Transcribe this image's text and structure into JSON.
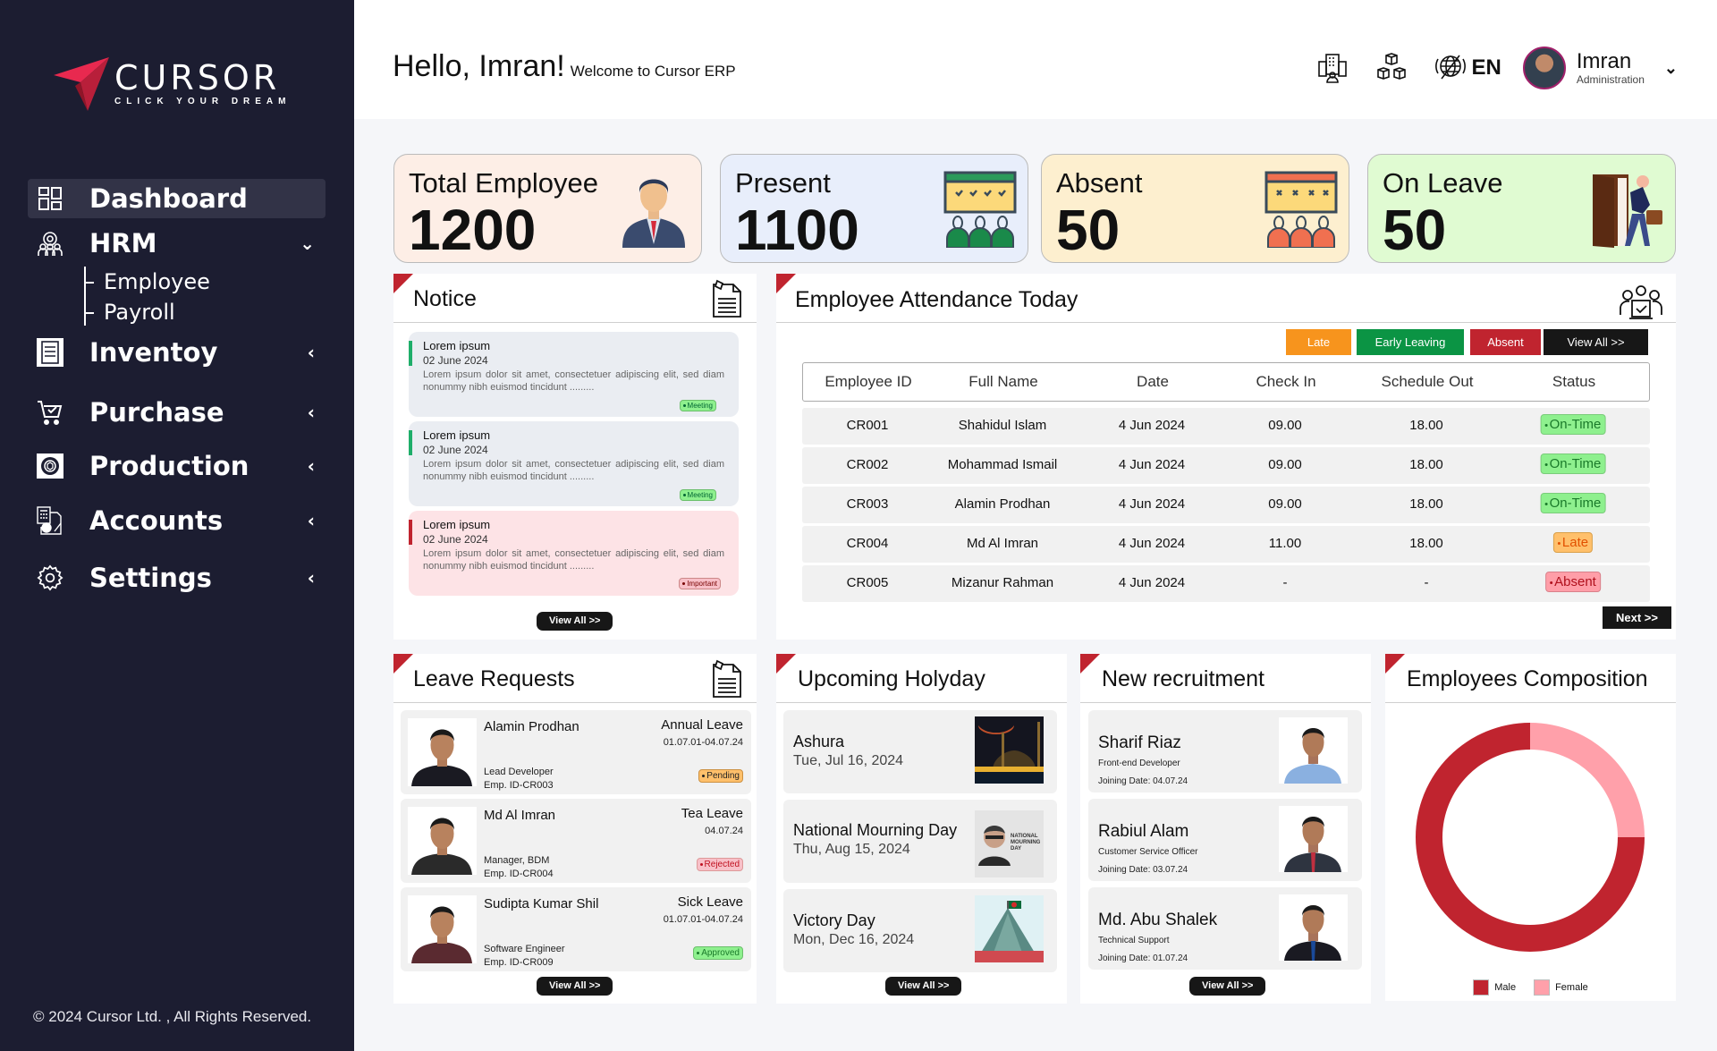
{
  "brand": {
    "name": "CURSOR",
    "tagline": "CLICK YOUR DREAM",
    "accent": "#c0242f"
  },
  "sidebar": {
    "items": [
      {
        "label": "Dashboard",
        "icon": "dashboard-icon",
        "active": true
      },
      {
        "label": "HRM",
        "icon": "hrm-team-gear-icon",
        "expanded": true,
        "children": [
          {
            "label": "Employee"
          },
          {
            "label": "Payroll"
          }
        ]
      },
      {
        "label": "Inventoy",
        "icon": "clipboard-icon"
      },
      {
        "label": "Purchase",
        "icon": "cart-icon"
      },
      {
        "label": "Production",
        "icon": "production-gear-icon"
      },
      {
        "label": "Accounts",
        "icon": "accounts-calculator-icon"
      },
      {
        "label": "Settings",
        "icon": "gear-icon"
      }
    ],
    "footer": "© 2024 Cursor Ltd. , All Rights Reserved."
  },
  "header": {
    "greeting": "Hello, Imran!",
    "subtitle": "Welcome to Cursor ERP",
    "icons": [
      "company-building-icon",
      "modules-boxes-icon",
      "language-globe-icon"
    ],
    "language": "EN",
    "user": {
      "name": "Imran",
      "role": "Administration"
    }
  },
  "stats": [
    {
      "label": "Total Employee",
      "value": "1200",
      "icon": "employee-icon",
      "bg": "#fdeee6"
    },
    {
      "label": "Present",
      "value": "1100",
      "icon": "present-calendar-icon",
      "bg": "#e8eefb"
    },
    {
      "label": "Absent",
      "value": "50",
      "icon": "absent-calendar-icon",
      "bg": "#fdefcf"
    },
    {
      "label": "On Leave",
      "value": "50",
      "icon": "on-leave-door-icon",
      "bg": "#e0fbd2"
    }
  ],
  "notice": {
    "title": "Notice",
    "items": [
      {
        "title": "Lorem ipsum",
        "date": "02 June 2024",
        "body": "Lorem ipsum dolor sit amet, consectetuer adipiscing elit, sed diam nonummy nibh euismod tincidunt .........",
        "tag": "Meeting"
      },
      {
        "title": "Lorem ipsum",
        "date": "02 June 2024",
        "body": "Lorem ipsum dolor sit amet, consectetuer adipiscing elit, sed diam nonummy nibh euismod tincidunt .........",
        "tag": "Meeting"
      },
      {
        "title": "Lorem ipsum",
        "date": "02 June 2024",
        "body": "Lorem ipsum dolor sit amet, consectetuer adipiscing elit, sed diam nonummy nibh euismod tincidunt .........",
        "tag": "Important"
      }
    ],
    "view_all": "View All >>"
  },
  "attendance": {
    "title": "Employee Attendance Today",
    "filters": [
      {
        "label": "Late",
        "color": "#f7941d"
      },
      {
        "label": "Early Leaving",
        "color": "#0b9444"
      },
      {
        "label": "Absent",
        "color": "#c0242f"
      },
      {
        "label": "View All >>",
        "color": "#171717"
      }
    ],
    "columns": [
      "Employee ID",
      "Full Name",
      "Date",
      "Check In",
      "Schedule Out",
      "Status"
    ],
    "rows": [
      {
        "id": "CR001",
        "name": "Shahidul Islam",
        "date": "4 Jun 2024",
        "in": "09.00",
        "out": "18.00",
        "status": "On-Time"
      },
      {
        "id": "CR002",
        "name": "Mohammad Ismail",
        "date": "4 Jun 2024",
        "in": "09.00",
        "out": "18.00",
        "status": "On-Time"
      },
      {
        "id": "CR003",
        "name": "Alamin Prodhan",
        "date": "4 Jun 2024",
        "in": "09.00",
        "out": "18.00",
        "status": "On-Time"
      },
      {
        "id": "CR004",
        "name": "Md Al Imran",
        "date": "4 Jun 2024",
        "in": "11.00",
        "out": "18.00",
        "status": "Late"
      },
      {
        "id": "CR005",
        "name": "Mizanur Rahman",
        "date": "4 Jun 2024",
        "in": "-",
        "out": "-",
        "status": "Absent"
      }
    ],
    "next": "Next >>"
  },
  "leave_requests": {
    "title": "Leave Requests",
    "items": [
      {
        "name": "Alamin Prodhan",
        "role": "Lead Developer",
        "emp_id": "Emp. ID-CR003",
        "type": "Annual Leave",
        "dates": "01.07.01-04.07.24",
        "status": "Pending"
      },
      {
        "name": "Md Al Imran",
        "role": "Manager, BDM",
        "emp_id": "Emp. ID-CR004",
        "type": "Tea Leave",
        "dates": "04.07.24",
        "status": "Rejected"
      },
      {
        "name": "Sudipta Kumar Shil",
        "role": "Software Engineer",
        "emp_id": "Emp. ID-CR009",
        "type": "Sick Leave",
        "dates": "01.07.01-04.07.24",
        "status": "Approved"
      }
    ],
    "view_all": "View All >>"
  },
  "holidays": {
    "title": "Upcoming Holyday",
    "items": [
      {
        "name": "Ashura",
        "date": "Tue, Jul 16, 2024"
      },
      {
        "name": "National Mourning Day",
        "date": "Thu, Aug 15, 2024",
        "image_caption": "NATIONAL MOURNING DAY"
      },
      {
        "name": "Victory Day",
        "date": "Mon, Dec 16, 2024"
      }
    ],
    "view_all": "View All >>"
  },
  "recruitment": {
    "title": "New recruitment",
    "items": [
      {
        "name": "Sharif Riaz",
        "role": "Front-end Developer",
        "joining": "Joining Date: 04.07.24"
      },
      {
        "name": "Rabiul Alam",
        "role": "Customer Service Officer",
        "joining": "Joining Date: 03.07.24"
      },
      {
        "name": "Md. Abu Shalek",
        "role": "Technical Support",
        "joining": "Joining Date: 01.07.24"
      }
    ],
    "view_all": "View All >>"
  },
  "composition": {
    "title": "Employees Composition"
  },
  "chart_data": {
    "type": "pie",
    "variant": "donut",
    "title": "Employees Composition",
    "categories": [
      "Male",
      "Female"
    ],
    "values": [
      75,
      25
    ],
    "unit": "percent",
    "colors": [
      "#c0242f",
      "#ffa0aa"
    ],
    "legend": "bottom"
  }
}
